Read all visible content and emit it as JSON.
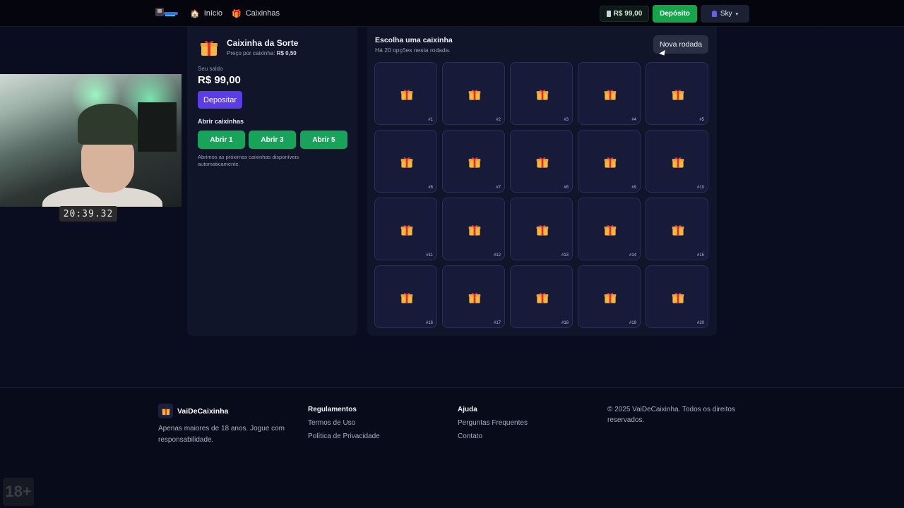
{
  "nav": {
    "home_label": "Início",
    "boxes_label": "Caixinhas",
    "balance": "R$ 99,00",
    "deposit_label": "Depósito",
    "user_name": "Sky",
    "user_caret": "▾"
  },
  "webcam": {
    "clock": "20:39.32"
  },
  "left_panel": {
    "title": "Caixinha da Sorte",
    "price_prefix": "Preço por caixinha:",
    "price_value": "R$ 0,50",
    "balance_label": "Seu saldo",
    "balance_value": "R$ 99,00",
    "deposit_button": "Depositar",
    "open_label": "Abrir caixinhas",
    "open_1": "Abrir 1",
    "open_3": "Abrir 3",
    "open_5": "Abrir 5",
    "auto_note": "Abrimos as próximas caixinhas disponíveis automaticamente."
  },
  "grid": {
    "title": "Escolha uma caixinha",
    "subtitle": "Há 20 opções nesta rodada.",
    "new_round_button": "Nova rodada",
    "boxes": [
      "#1",
      "#2",
      "#3",
      "#4",
      "#5",
      "#6",
      "#7",
      "#8",
      "#9",
      "#10",
      "#11",
      "#12",
      "#13",
      "#14",
      "#15",
      "#16",
      "#17",
      "#18",
      "#19",
      "#20"
    ]
  },
  "footer": {
    "brand": "VaiDeCaixinha",
    "description": "Apenas maiores de 18 anos. Jogue com responsabilidade.",
    "col1_title": "Regulamentos",
    "col1_links": [
      "Termos de Uso",
      "Política de Privacidade"
    ],
    "col2_title": "Ajuda",
    "col2_links": [
      "Perguntas Frequentes",
      "Contato"
    ],
    "copyright": "© 2025 VaiDeCaixinha. Todos os direitos reservados.",
    "age_badge": "18+"
  },
  "colors": {
    "accent_green": "#16a34a",
    "accent_purple": "#5a3de6",
    "panel_bg": "#111529",
    "page_bg": "#0a0d1f"
  },
  "icons": {
    "gift": "gift-icon",
    "home": "home-icon",
    "wallet": "wallet-icon",
    "user": "user-icon"
  }
}
